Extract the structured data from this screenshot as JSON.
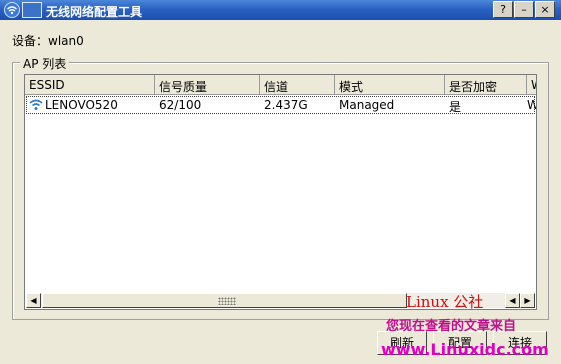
{
  "window": {
    "title": "无线网络配置工具",
    "buttons": [
      "?",
      "–",
      "×"
    ]
  },
  "device": {
    "label": "设备：wlan0"
  },
  "ap_group": {
    "title": "AP 列表"
  },
  "table": {
    "columns": [
      "ESSID",
      "信号质量",
      "信道",
      "模式",
      "是否加密",
      "W"
    ],
    "rows": [
      {
        "essid": "LENOVO520",
        "quality": "62/100",
        "channel": "2.437G",
        "mode": "Managed",
        "encrypted": "是",
        "w": "W"
      }
    ]
  },
  "buttons": {
    "refresh": "刷新",
    "config": "配置",
    "connect": "连接"
  },
  "watermark": {
    "line1": "Linux 公社",
    "line2": "您现在查看的文章来自",
    "line3": "www.Linuxidc.com"
  }
}
